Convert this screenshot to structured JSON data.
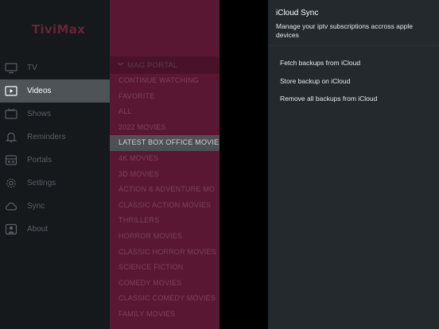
{
  "app": {
    "logo_text": "TiviMax"
  },
  "sidebar": {
    "items": [
      {
        "label": "TV",
        "icon": "tv-icon",
        "active": false
      },
      {
        "label": "Videos",
        "icon": "play-icon",
        "active": true
      },
      {
        "label": "Shows",
        "icon": "film-icon",
        "active": false
      },
      {
        "label": "Reminders",
        "icon": "bell-icon",
        "active": false
      },
      {
        "label": "Portals",
        "icon": "portal-icon",
        "active": false
      },
      {
        "label": "Settings",
        "icon": "gear-icon",
        "active": false
      },
      {
        "label": "Sync",
        "icon": "cloud-icon",
        "active": false
      },
      {
        "label": "About",
        "icon": "person-icon",
        "active": false
      }
    ]
  },
  "categories": {
    "header": "MAG PORTAL",
    "items": [
      "CONTINUE WATCHING",
      "FAVORITE",
      "ALL",
      "2022 MOVIES",
      "LATEST BOX OFFICE MOVIE",
      "4K MOVIES",
      "3D MOVIES",
      "ACTION & ADVENTURE MO",
      "CLASSIC ACTION MOVIES",
      "THRILLERS",
      "HORROR MOVIES",
      "CLASSIC HORROR MOVIES",
      "SCIENCE FICTION",
      "COMEDY MOVIES",
      "CLASSIC COMEDY MOVIES",
      "FAMILY MOVIES"
    ],
    "selected": "LATEST BOX OFFICE MOVIE"
  },
  "icloud": {
    "title": "iCloud Sync",
    "description": "Manage your iptv subscriptions accross apple devices",
    "actions": [
      "Fetch backups from iCloud",
      "Store backup on iCloud",
      "Remove all backups from iCloud"
    ]
  },
  "colors": {
    "sidebar_bg": "#15191c",
    "sidebar_active_bg": "#4e5357",
    "category_bg": "#5a1733",
    "panel_bg": "#23292d",
    "logo": "#6b2236"
  }
}
